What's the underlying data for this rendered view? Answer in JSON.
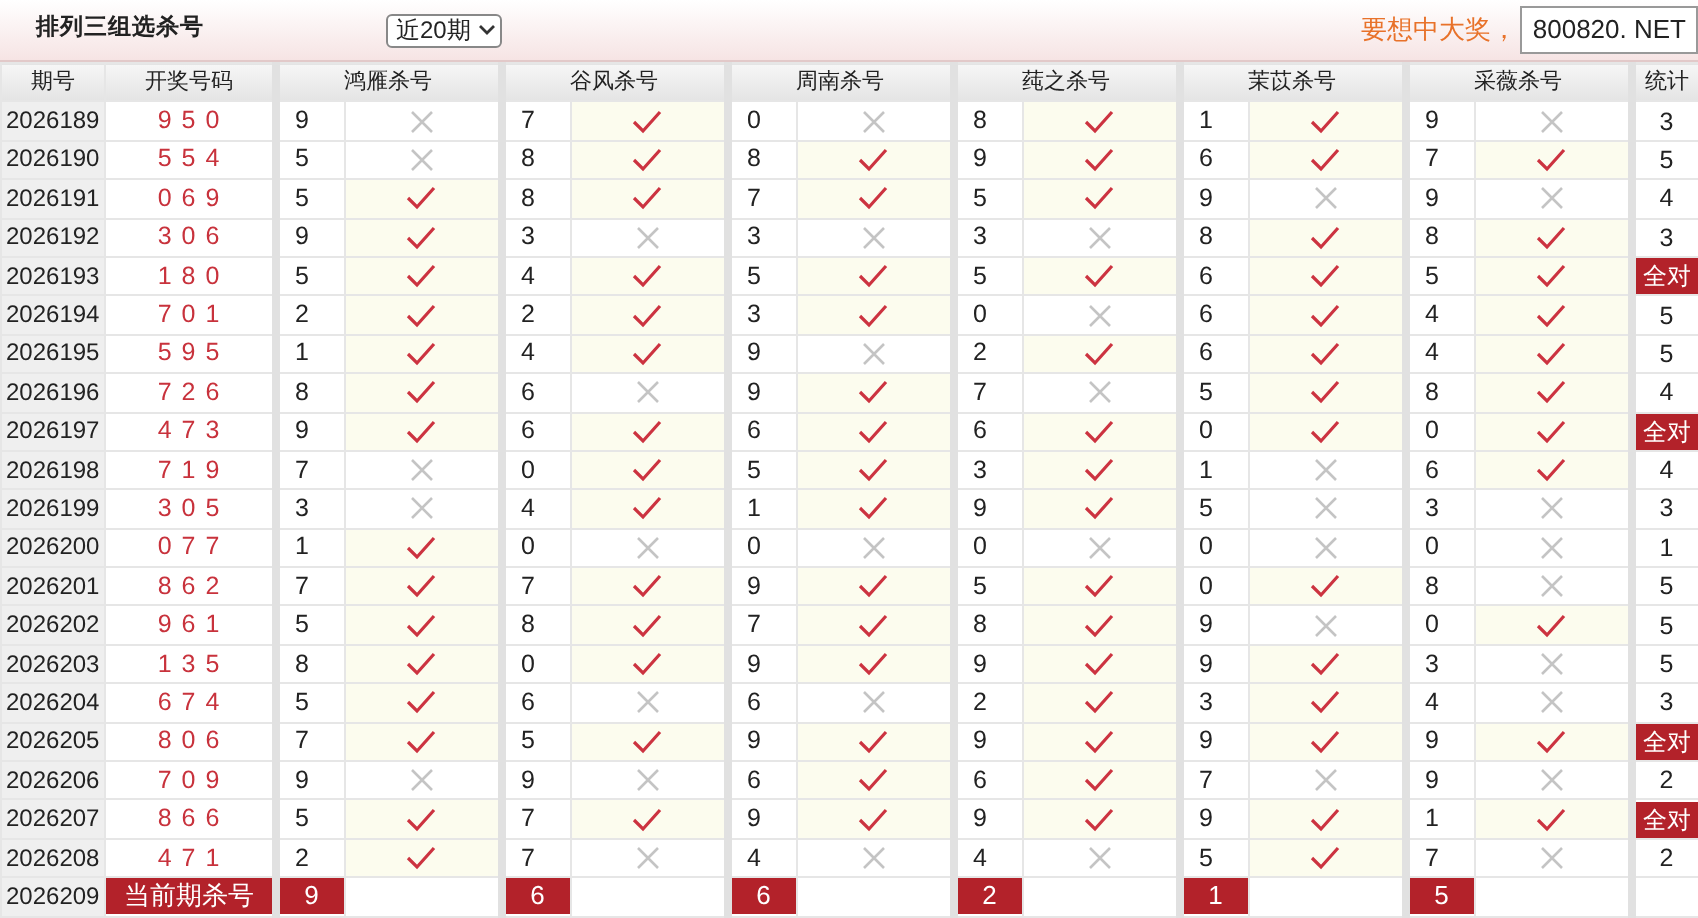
{
  "header": {
    "title": "排列三组选杀号",
    "period_select": "近20期",
    "slogan": "要想中大奖，",
    "site_badge": "800820. NET"
  },
  "columns": [
    "期号",
    "开奖号码",
    "鸿雁杀号",
    "谷风杀号",
    "周南杀号",
    "莼之杀号",
    "茉苡杀号",
    "采薇杀号",
    "统计"
  ],
  "rows": [
    {
      "issue": "2026189",
      "draw": "950",
      "kills": [
        {
          "num": "9",
          "hit": false
        },
        {
          "num": "7",
          "hit": true
        },
        {
          "num": "0",
          "hit": false
        },
        {
          "num": "8",
          "hit": true
        },
        {
          "num": "1",
          "hit": true
        },
        {
          "num": "9",
          "hit": false
        }
      ],
      "stat": "3",
      "all_correct": false
    },
    {
      "issue": "2026190",
      "draw": "554",
      "kills": [
        {
          "num": "5",
          "hit": false
        },
        {
          "num": "8",
          "hit": true
        },
        {
          "num": "8",
          "hit": true
        },
        {
          "num": "9",
          "hit": true
        },
        {
          "num": "6",
          "hit": true
        },
        {
          "num": "7",
          "hit": true
        }
      ],
      "stat": "5",
      "all_correct": false
    },
    {
      "issue": "2026191",
      "draw": "069",
      "kills": [
        {
          "num": "5",
          "hit": true
        },
        {
          "num": "8",
          "hit": true
        },
        {
          "num": "7",
          "hit": true
        },
        {
          "num": "5",
          "hit": true
        },
        {
          "num": "9",
          "hit": false
        },
        {
          "num": "9",
          "hit": false
        }
      ],
      "stat": "4",
      "all_correct": false
    },
    {
      "issue": "2026192",
      "draw": "306",
      "kills": [
        {
          "num": "9",
          "hit": true
        },
        {
          "num": "3",
          "hit": false
        },
        {
          "num": "3",
          "hit": false
        },
        {
          "num": "3",
          "hit": false
        },
        {
          "num": "8",
          "hit": true
        },
        {
          "num": "8",
          "hit": true
        }
      ],
      "stat": "3",
      "all_correct": false
    },
    {
      "issue": "2026193",
      "draw": "180",
      "kills": [
        {
          "num": "5",
          "hit": true
        },
        {
          "num": "4",
          "hit": true
        },
        {
          "num": "5",
          "hit": true
        },
        {
          "num": "5",
          "hit": true
        },
        {
          "num": "6",
          "hit": true
        },
        {
          "num": "5",
          "hit": true
        }
      ],
      "stat": "全对",
      "all_correct": true
    },
    {
      "issue": "2026194",
      "draw": "701",
      "kills": [
        {
          "num": "2",
          "hit": true
        },
        {
          "num": "2",
          "hit": true
        },
        {
          "num": "3",
          "hit": true
        },
        {
          "num": "0",
          "hit": false
        },
        {
          "num": "6",
          "hit": true
        },
        {
          "num": "4",
          "hit": true
        }
      ],
      "stat": "5",
      "all_correct": false
    },
    {
      "issue": "2026195",
      "draw": "595",
      "kills": [
        {
          "num": "1",
          "hit": true
        },
        {
          "num": "4",
          "hit": true
        },
        {
          "num": "9",
          "hit": false
        },
        {
          "num": "2",
          "hit": true
        },
        {
          "num": "6",
          "hit": true
        },
        {
          "num": "4",
          "hit": true
        }
      ],
      "stat": "5",
      "all_correct": false
    },
    {
      "issue": "2026196",
      "draw": "726",
      "kills": [
        {
          "num": "8",
          "hit": true
        },
        {
          "num": "6",
          "hit": false
        },
        {
          "num": "9",
          "hit": true
        },
        {
          "num": "7",
          "hit": false
        },
        {
          "num": "5",
          "hit": true
        },
        {
          "num": "8",
          "hit": true
        }
      ],
      "stat": "4",
      "all_correct": false
    },
    {
      "issue": "2026197",
      "draw": "473",
      "kills": [
        {
          "num": "9",
          "hit": true
        },
        {
          "num": "6",
          "hit": true
        },
        {
          "num": "6",
          "hit": true
        },
        {
          "num": "6",
          "hit": true
        },
        {
          "num": "0",
          "hit": true
        },
        {
          "num": "0",
          "hit": true
        }
      ],
      "stat": "全对",
      "all_correct": true
    },
    {
      "issue": "2026198",
      "draw": "719",
      "kills": [
        {
          "num": "7",
          "hit": false
        },
        {
          "num": "0",
          "hit": true
        },
        {
          "num": "5",
          "hit": true
        },
        {
          "num": "3",
          "hit": true
        },
        {
          "num": "1",
          "hit": false
        },
        {
          "num": "6",
          "hit": true
        }
      ],
      "stat": "4",
      "all_correct": false
    },
    {
      "issue": "2026199",
      "draw": "305",
      "kills": [
        {
          "num": "3",
          "hit": false
        },
        {
          "num": "4",
          "hit": true
        },
        {
          "num": "1",
          "hit": true
        },
        {
          "num": "9",
          "hit": true
        },
        {
          "num": "5",
          "hit": false
        },
        {
          "num": "3",
          "hit": false
        }
      ],
      "stat": "3",
      "all_correct": false
    },
    {
      "issue": "2026200",
      "draw": "077",
      "kills": [
        {
          "num": "1",
          "hit": true
        },
        {
          "num": "0",
          "hit": false
        },
        {
          "num": "0",
          "hit": false
        },
        {
          "num": "0",
          "hit": false
        },
        {
          "num": "0",
          "hit": false
        },
        {
          "num": "0",
          "hit": false
        }
      ],
      "stat": "1",
      "all_correct": false
    },
    {
      "issue": "2026201",
      "draw": "862",
      "kills": [
        {
          "num": "7",
          "hit": true
        },
        {
          "num": "7",
          "hit": true
        },
        {
          "num": "9",
          "hit": true
        },
        {
          "num": "5",
          "hit": true
        },
        {
          "num": "0",
          "hit": true
        },
        {
          "num": "8",
          "hit": false
        }
      ],
      "stat": "5",
      "all_correct": false
    },
    {
      "issue": "2026202",
      "draw": "961",
      "kills": [
        {
          "num": "5",
          "hit": true
        },
        {
          "num": "8",
          "hit": true
        },
        {
          "num": "7",
          "hit": true
        },
        {
          "num": "8",
          "hit": true
        },
        {
          "num": "9",
          "hit": false
        },
        {
          "num": "0",
          "hit": true
        }
      ],
      "stat": "5",
      "all_correct": false
    },
    {
      "issue": "2026203",
      "draw": "135",
      "kills": [
        {
          "num": "8",
          "hit": true
        },
        {
          "num": "0",
          "hit": true
        },
        {
          "num": "9",
          "hit": true
        },
        {
          "num": "9",
          "hit": true
        },
        {
          "num": "9",
          "hit": true
        },
        {
          "num": "3",
          "hit": false
        }
      ],
      "stat": "5",
      "all_correct": false
    },
    {
      "issue": "2026204",
      "draw": "674",
      "kills": [
        {
          "num": "5",
          "hit": true
        },
        {
          "num": "6",
          "hit": false
        },
        {
          "num": "6",
          "hit": false
        },
        {
          "num": "2",
          "hit": true
        },
        {
          "num": "3",
          "hit": true
        },
        {
          "num": "4",
          "hit": false
        }
      ],
      "stat": "3",
      "all_correct": false
    },
    {
      "issue": "2026205",
      "draw": "806",
      "kills": [
        {
          "num": "7",
          "hit": true
        },
        {
          "num": "5",
          "hit": true
        },
        {
          "num": "9",
          "hit": true
        },
        {
          "num": "9",
          "hit": true
        },
        {
          "num": "9",
          "hit": true
        },
        {
          "num": "9",
          "hit": true
        }
      ],
      "stat": "全对",
      "all_correct": true
    },
    {
      "issue": "2026206",
      "draw": "709",
      "kills": [
        {
          "num": "9",
          "hit": false
        },
        {
          "num": "9",
          "hit": false
        },
        {
          "num": "6",
          "hit": true
        },
        {
          "num": "6",
          "hit": true
        },
        {
          "num": "7",
          "hit": false
        },
        {
          "num": "9",
          "hit": false
        }
      ],
      "stat": "2",
      "all_correct": false
    },
    {
      "issue": "2026207",
      "draw": "866",
      "kills": [
        {
          "num": "5",
          "hit": true
        },
        {
          "num": "7",
          "hit": true
        },
        {
          "num": "9",
          "hit": true
        },
        {
          "num": "9",
          "hit": true
        },
        {
          "num": "9",
          "hit": true
        },
        {
          "num": "1",
          "hit": true
        }
      ],
      "stat": "全对",
      "all_correct": true
    },
    {
      "issue": "2026208",
      "draw": "471",
      "kills": [
        {
          "num": "2",
          "hit": true
        },
        {
          "num": "7",
          "hit": false
        },
        {
          "num": "4",
          "hit": false
        },
        {
          "num": "4",
          "hit": false
        },
        {
          "num": "5",
          "hit": true
        },
        {
          "num": "7",
          "hit": false
        }
      ],
      "stat": "2",
      "all_correct": false
    }
  ],
  "current": {
    "issue": "2026209",
    "label": "当前期杀号",
    "kills": [
      "9",
      "6",
      "6",
      "2",
      "1",
      "5"
    ]
  }
}
